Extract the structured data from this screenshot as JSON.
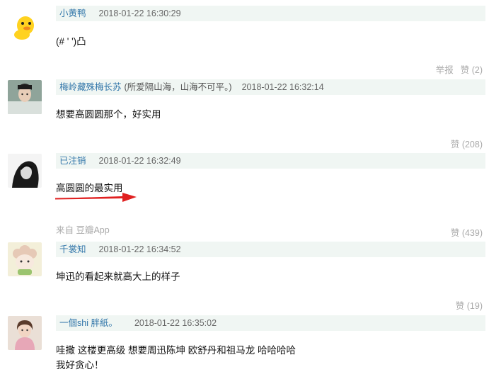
{
  "colors": {
    "meta_bg": "#f0f6f3",
    "author": "#3377aa",
    "muted": "#aaaaaa",
    "arrow": "#e02020"
  },
  "comments": [
    {
      "avatar_icon": "yellow-duck-avatar-icon",
      "author": "小黄鸭",
      "signature": "",
      "time": "2018-01-22 16:30:29",
      "lines": [
        "(# ' ')凸"
      ],
      "report": "举报",
      "like": "赞 (2)",
      "source": ""
    },
    {
      "avatar_icon": "man-in-costume-avatar-icon",
      "author": "梅岭藏殊梅长苏",
      "signature": "(所爱隔山海，山海不可平。)",
      "time": "2018-01-22 16:32:14",
      "lines": [
        "想要高圆圆那个，好实用"
      ],
      "report": "",
      "like": "赞 (208)",
      "source": ""
    },
    {
      "avatar_icon": "portrait-bw-avatar-icon",
      "author": "已注销",
      "signature": "",
      "time": "2018-01-22 16:32:49",
      "lines": [
        "高圆圆的最实用"
      ],
      "report": "",
      "like": "赞 (439)",
      "source": "来自 豆瓣App"
    },
    {
      "avatar_icon": "sheep-cartoon-avatar-icon",
      "author": "千裳知",
      "signature": "",
      "time": "2018-01-22 16:34:52",
      "lines": [
        "坤迅的看起来就高大上的样子"
      ],
      "report": "",
      "like": "赞 (19)",
      "source": ""
    },
    {
      "avatar_icon": "girl-photo-avatar-icon",
      "author": "一個shi 胖紙。",
      "signature": "",
      "time": "2018-01-22 16:35:02",
      "lines": [
        "哇撒 这楼更高级 想要周迅陈坤 欧舒丹和祖马龙 哈哈哈哈",
        "我好贪心！"
      ],
      "report": "",
      "like": "",
      "source": ""
    }
  ]
}
